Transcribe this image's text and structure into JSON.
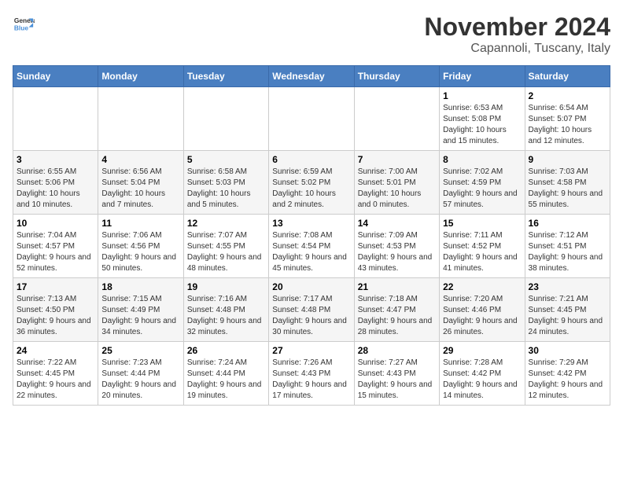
{
  "header": {
    "logo_line1": "General",
    "logo_line2": "Blue",
    "month": "November 2024",
    "location": "Capannoli, Tuscany, Italy"
  },
  "weekdays": [
    "Sunday",
    "Monday",
    "Tuesday",
    "Wednesday",
    "Thursday",
    "Friday",
    "Saturday"
  ],
  "weeks": [
    [
      {
        "day": "",
        "info": ""
      },
      {
        "day": "",
        "info": ""
      },
      {
        "day": "",
        "info": ""
      },
      {
        "day": "",
        "info": ""
      },
      {
        "day": "",
        "info": ""
      },
      {
        "day": "1",
        "info": "Sunrise: 6:53 AM\nSunset: 5:08 PM\nDaylight: 10 hours and 15 minutes."
      },
      {
        "day": "2",
        "info": "Sunrise: 6:54 AM\nSunset: 5:07 PM\nDaylight: 10 hours and 12 minutes."
      }
    ],
    [
      {
        "day": "3",
        "info": "Sunrise: 6:55 AM\nSunset: 5:06 PM\nDaylight: 10 hours and 10 minutes."
      },
      {
        "day": "4",
        "info": "Sunrise: 6:56 AM\nSunset: 5:04 PM\nDaylight: 10 hours and 7 minutes."
      },
      {
        "day": "5",
        "info": "Sunrise: 6:58 AM\nSunset: 5:03 PM\nDaylight: 10 hours and 5 minutes."
      },
      {
        "day": "6",
        "info": "Sunrise: 6:59 AM\nSunset: 5:02 PM\nDaylight: 10 hours and 2 minutes."
      },
      {
        "day": "7",
        "info": "Sunrise: 7:00 AM\nSunset: 5:01 PM\nDaylight: 10 hours and 0 minutes."
      },
      {
        "day": "8",
        "info": "Sunrise: 7:02 AM\nSunset: 4:59 PM\nDaylight: 9 hours and 57 minutes."
      },
      {
        "day": "9",
        "info": "Sunrise: 7:03 AM\nSunset: 4:58 PM\nDaylight: 9 hours and 55 minutes."
      }
    ],
    [
      {
        "day": "10",
        "info": "Sunrise: 7:04 AM\nSunset: 4:57 PM\nDaylight: 9 hours and 52 minutes."
      },
      {
        "day": "11",
        "info": "Sunrise: 7:06 AM\nSunset: 4:56 PM\nDaylight: 9 hours and 50 minutes."
      },
      {
        "day": "12",
        "info": "Sunrise: 7:07 AM\nSunset: 4:55 PM\nDaylight: 9 hours and 48 minutes."
      },
      {
        "day": "13",
        "info": "Sunrise: 7:08 AM\nSunset: 4:54 PM\nDaylight: 9 hours and 45 minutes."
      },
      {
        "day": "14",
        "info": "Sunrise: 7:09 AM\nSunset: 4:53 PM\nDaylight: 9 hours and 43 minutes."
      },
      {
        "day": "15",
        "info": "Sunrise: 7:11 AM\nSunset: 4:52 PM\nDaylight: 9 hours and 41 minutes."
      },
      {
        "day": "16",
        "info": "Sunrise: 7:12 AM\nSunset: 4:51 PM\nDaylight: 9 hours and 38 minutes."
      }
    ],
    [
      {
        "day": "17",
        "info": "Sunrise: 7:13 AM\nSunset: 4:50 PM\nDaylight: 9 hours and 36 minutes."
      },
      {
        "day": "18",
        "info": "Sunrise: 7:15 AM\nSunset: 4:49 PM\nDaylight: 9 hours and 34 minutes."
      },
      {
        "day": "19",
        "info": "Sunrise: 7:16 AM\nSunset: 4:48 PM\nDaylight: 9 hours and 32 minutes."
      },
      {
        "day": "20",
        "info": "Sunrise: 7:17 AM\nSunset: 4:48 PM\nDaylight: 9 hours and 30 minutes."
      },
      {
        "day": "21",
        "info": "Sunrise: 7:18 AM\nSunset: 4:47 PM\nDaylight: 9 hours and 28 minutes."
      },
      {
        "day": "22",
        "info": "Sunrise: 7:20 AM\nSunset: 4:46 PM\nDaylight: 9 hours and 26 minutes."
      },
      {
        "day": "23",
        "info": "Sunrise: 7:21 AM\nSunset: 4:45 PM\nDaylight: 9 hours and 24 minutes."
      }
    ],
    [
      {
        "day": "24",
        "info": "Sunrise: 7:22 AM\nSunset: 4:45 PM\nDaylight: 9 hours and 22 minutes."
      },
      {
        "day": "25",
        "info": "Sunrise: 7:23 AM\nSunset: 4:44 PM\nDaylight: 9 hours and 20 minutes."
      },
      {
        "day": "26",
        "info": "Sunrise: 7:24 AM\nSunset: 4:44 PM\nDaylight: 9 hours and 19 minutes."
      },
      {
        "day": "27",
        "info": "Sunrise: 7:26 AM\nSunset: 4:43 PM\nDaylight: 9 hours and 17 minutes."
      },
      {
        "day": "28",
        "info": "Sunrise: 7:27 AM\nSunset: 4:43 PM\nDaylight: 9 hours and 15 minutes."
      },
      {
        "day": "29",
        "info": "Sunrise: 7:28 AM\nSunset: 4:42 PM\nDaylight: 9 hours and 14 minutes."
      },
      {
        "day": "30",
        "info": "Sunrise: 7:29 AM\nSunset: 4:42 PM\nDaylight: 9 hours and 12 minutes."
      }
    ]
  ]
}
